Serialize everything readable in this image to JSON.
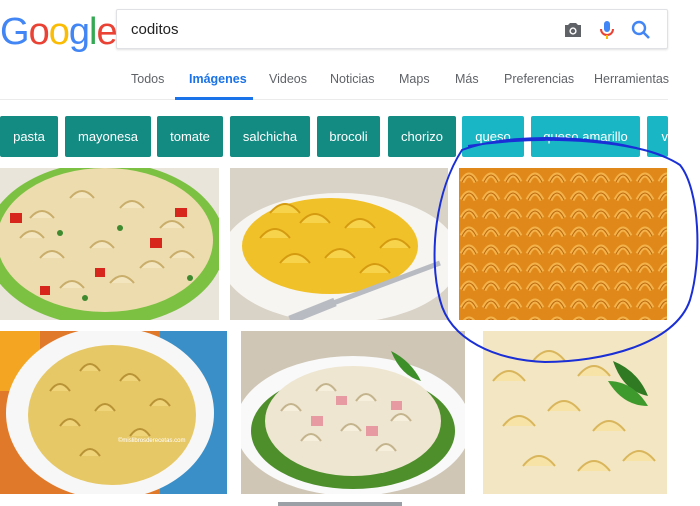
{
  "logo": {
    "letters": [
      "G",
      "o",
      "o",
      "g",
      "l",
      "e"
    ],
    "colors": [
      "#4285f4",
      "#ea4335",
      "#fbbc05",
      "#4285f4",
      "#34a853",
      "#ea4335"
    ]
  },
  "search": {
    "query": "coditos",
    "icons": [
      "camera-icon",
      "microphone-icon",
      "search-icon"
    ]
  },
  "tabs": [
    {
      "label": "Todos",
      "active": false
    },
    {
      "label": "Imágenes",
      "active": true
    },
    {
      "label": "Videos",
      "active": false
    },
    {
      "label": "Noticias",
      "active": false
    },
    {
      "label": "Maps",
      "active": false
    },
    {
      "label": "Más",
      "active": false
    },
    {
      "label": "Preferencias",
      "active": false
    },
    {
      "label": "Herramientas",
      "active": false
    }
  ],
  "chips": [
    {
      "label": "pasta"
    },
    {
      "label": "mayonesa"
    },
    {
      "label": "tomate"
    },
    {
      "label": "salchicha"
    },
    {
      "label": "brocoli"
    },
    {
      "label": "chorizo"
    },
    {
      "label": "queso"
    },
    {
      "label": "queso amarillo"
    },
    {
      "label": "v"
    }
  ],
  "colors": {
    "chip_dark": "#138a82",
    "chip_light": "#19b7c5",
    "accent": "#1a73e8",
    "annotation": "#1a2fd6"
  },
  "images": [
    {
      "name": "macaroni-salad-green-bowl"
    },
    {
      "name": "mac-and-cheese-plate-fork"
    },
    {
      "name": "raw-elbow-macaroni-closeup"
    },
    {
      "name": "dry-macaroni-white-bowl"
    },
    {
      "name": "macaroni-ham-salad-lettuce"
    },
    {
      "name": "creamy-macaroni-parsley"
    }
  ],
  "images_watermark": "©mislibrosderecetas.com",
  "annotation": "hand-drawn-circle"
}
